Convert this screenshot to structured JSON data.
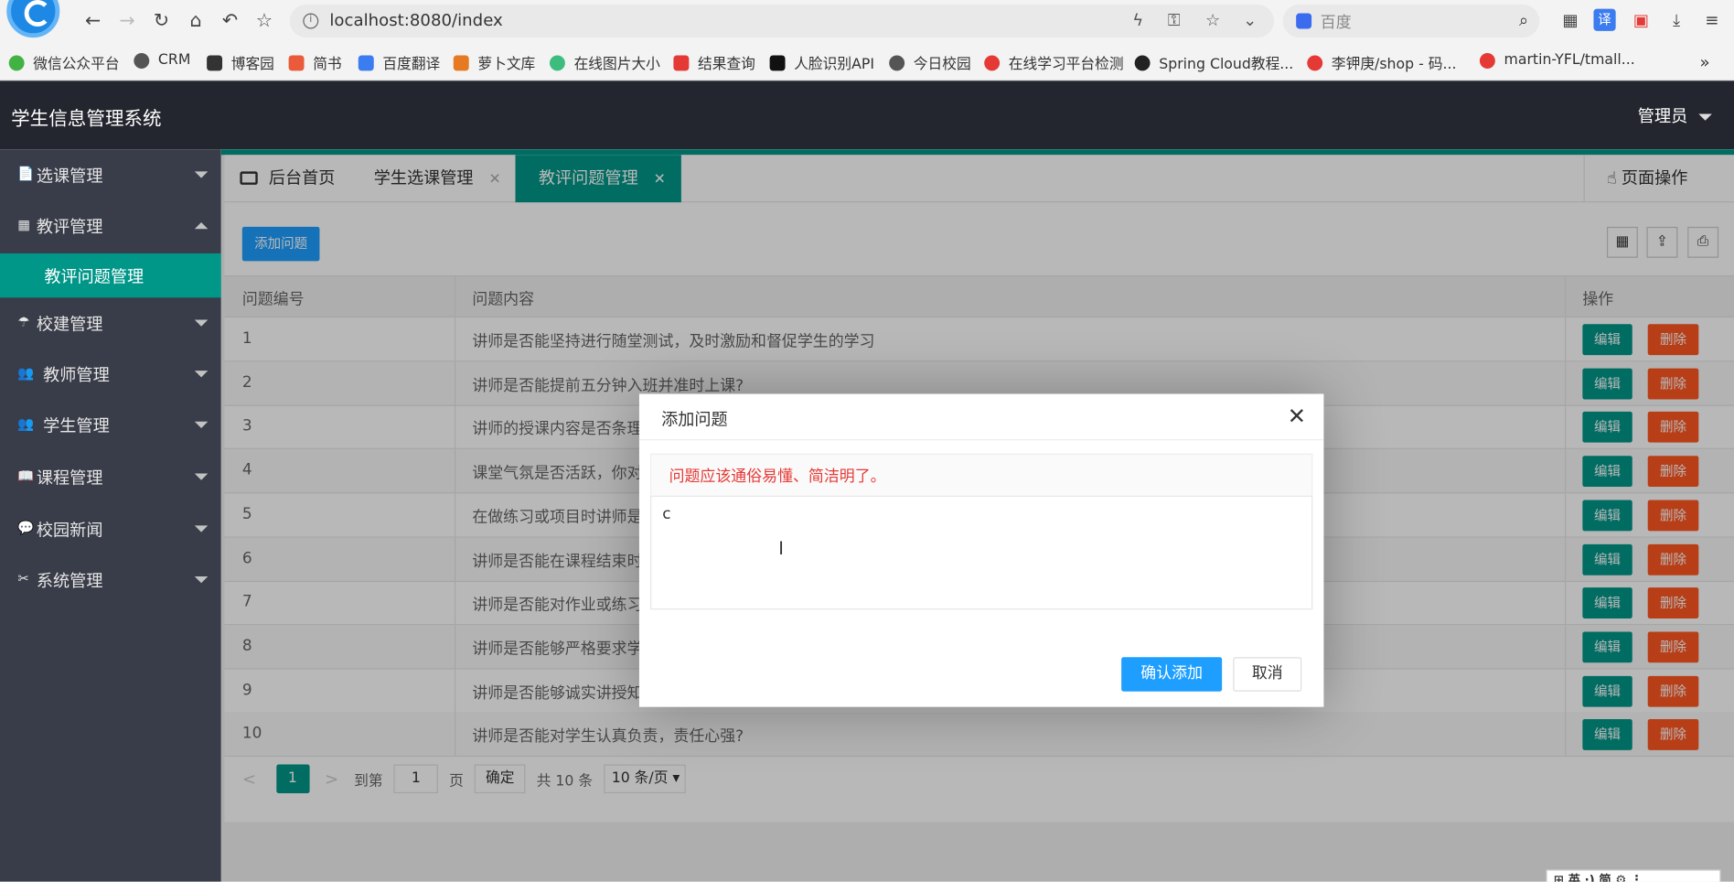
{
  "browser": {
    "url": "localhost:8080/index",
    "search_placeholder": "百度",
    "bookmarks": [
      {
        "label": "微信公众平台",
        "color": "#43b244"
      },
      {
        "label": "CRM",
        "color": "#555555"
      },
      {
        "label": "博客园",
        "color": "#333333"
      },
      {
        "label": "简书",
        "color": "#e95b3b"
      },
      {
        "label": "百度翻译",
        "color": "#3b7cf0"
      },
      {
        "label": "萝卜文库",
        "color": "#e67a22"
      },
      {
        "label": "在线图片大小",
        "color": "#3dbd7d"
      },
      {
        "label": "结果查询",
        "color": "#e53935"
      },
      {
        "label": "人脸识别API",
        "color": "#111111"
      },
      {
        "label": "今日校园",
        "color": "#555555"
      },
      {
        "label": "在线学习平台检测",
        "color": "#e53935"
      },
      {
        "label": "Spring Cloud教程...",
        "color": "#222222"
      },
      {
        "label": "李钾庚/shop - 码...",
        "color": "#e53935"
      },
      {
        "label": "martin-YFL/tmall...",
        "color": "#e53935"
      }
    ]
  },
  "app": {
    "title": "学生信息管理系统",
    "user": "管理员"
  },
  "sidebar": {
    "items": [
      {
        "label": "选课管理",
        "icon": "📄"
      },
      {
        "label": "教评管理",
        "icon": "▦"
      },
      {
        "label": "校建管理",
        "icon": "☂"
      },
      {
        "label": "教师管理",
        "icon": "👥"
      },
      {
        "label": "学生管理",
        "icon": "👥"
      },
      {
        "label": "课程管理",
        "icon": "📖"
      },
      {
        "label": "校园新闻",
        "icon": "💬"
      },
      {
        "label": "系统管理",
        "icon": "✂"
      }
    ],
    "active_sub": "教评问题管理"
  },
  "tabs": {
    "home": "后台首页",
    "t1": "学生选课管理",
    "t2": "教评问题管理",
    "page_ops": "页面操作"
  },
  "toolbar": {
    "add": "添加问题"
  },
  "table": {
    "headers": [
      "问题编号",
      "问题内容",
      "操作"
    ],
    "edit": "编辑",
    "del": "删除",
    "rows": [
      {
        "id": "1",
        "q": "讲师是否能坚持进行随堂测试，及时激励和督促学生的学习"
      },
      {
        "id": "2",
        "q": "讲师是否能提前五分钟入班并准时上课?"
      },
      {
        "id": "3",
        "q": "讲师的授课内容是否条理"
      },
      {
        "id": "4",
        "q": "课堂气氛是否活跃，你对"
      },
      {
        "id": "5",
        "q": "在做练习或项目时讲师是"
      },
      {
        "id": "6",
        "q": "讲师是否能在课程结束时"
      },
      {
        "id": "7",
        "q": "讲师是否能对作业或练习"
      },
      {
        "id": "8",
        "q": "讲师是否能够严格要求学"
      },
      {
        "id": "9",
        "q": "讲师是否能够诚实讲授知"
      },
      {
        "id": "10",
        "q": "讲师是否能对学生认真负责，责任心强?"
      }
    ]
  },
  "pager": {
    "current": "1",
    "goto": "到第",
    "page_input": "1",
    "page_unit": "页",
    "ok": "确定",
    "total": "共 10 条",
    "per_page": "10 条/页"
  },
  "modal": {
    "title": "添加问题",
    "hint": "问题应该通俗易懂、简洁明了。",
    "textarea_value": "c",
    "confirm": "确认添加",
    "cancel": "取消"
  },
  "ime": "⊞ 英 ·) 简 ⚙ ⋮"
}
